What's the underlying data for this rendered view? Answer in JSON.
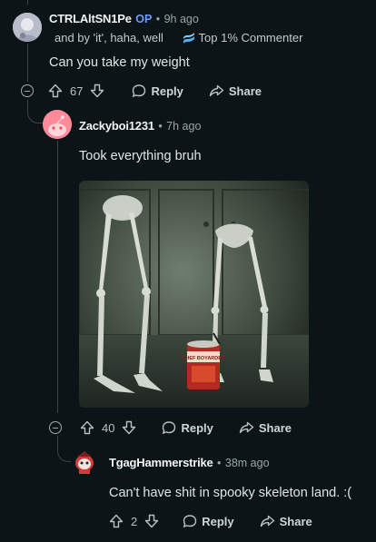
{
  "comments": [
    {
      "username": "CTRLAltSN1Pe",
      "op_badge": "OP",
      "time": "9h ago",
      "quoted_snippet": "and by 'it', haha, well",
      "flair": "Top 1% Commenter",
      "text": "Can you take my weight",
      "votes": "67",
      "reply_label": "Reply",
      "share_label": "Share"
    },
    {
      "username": "Zackyboi1231",
      "time": "7h ago",
      "text": "Took everything bruh",
      "image_alt": "Two skeleton legs standing next to a can of Chef Boyardee",
      "can_label": "CHEF BOYARDEE",
      "votes": "40",
      "reply_label": "Reply",
      "share_label": "Share"
    },
    {
      "username": "TgagHammerstrike",
      "time": "38m ago",
      "text": "Can't have shit in spooky skeleton land. :(",
      "votes": "2",
      "reply_label": "Reply",
      "share_label": "Share"
    }
  ],
  "colors": {
    "background": "#0b1416",
    "op_badge": "#6f9bff",
    "avatar_pink": "#ff8a9a",
    "flair_icon": "#4fb6ff"
  },
  "icons": [
    "upvote-icon",
    "downvote-icon",
    "reply-icon",
    "share-icon",
    "collapse-icon",
    "flair-icon"
  ]
}
